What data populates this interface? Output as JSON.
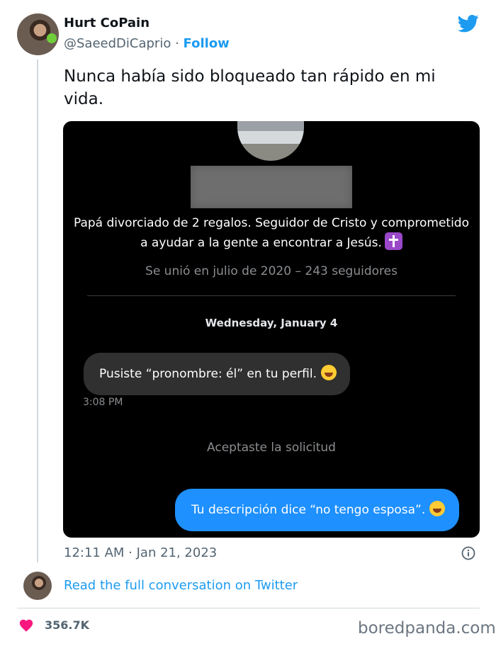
{
  "author": {
    "name": "Hurt CoPain",
    "handle": "@SaeedDiCaprio",
    "separator": "·",
    "follow_label": "Follow"
  },
  "tweet": {
    "text": "Nunca había sido bloqueado tan rápido en mi vida.",
    "timestamp": "12:11 AM · Jan 21, 2023"
  },
  "screenshot": {
    "bio_line1": "Papá divorciado de 2 regalos. Seguidor de Cristo y comprometido",
    "bio_line2": "a ayudar a la gente a encontrar a Jesús.",
    "joined": "Se unió en julio de 2020 – 243 seguidores",
    "date_header": "Wednesday, January 4",
    "incoming_message": "Pusiste “pronombre: él” en tu perfil.",
    "incoming_time": "3:08 PM",
    "accepted_notice": "Aceptaste la solicitud",
    "outgoing_message": "Tu descripción dice “no tengo esposa”."
  },
  "footer": {
    "read_link": "Read the full conversation on Twitter",
    "likes": "356.7K",
    "watermark": "boredpanda.com"
  },
  "colors": {
    "accent": "#1d9bf0",
    "like": "#f91880",
    "outgoing_bubble": "#1e90ff"
  }
}
